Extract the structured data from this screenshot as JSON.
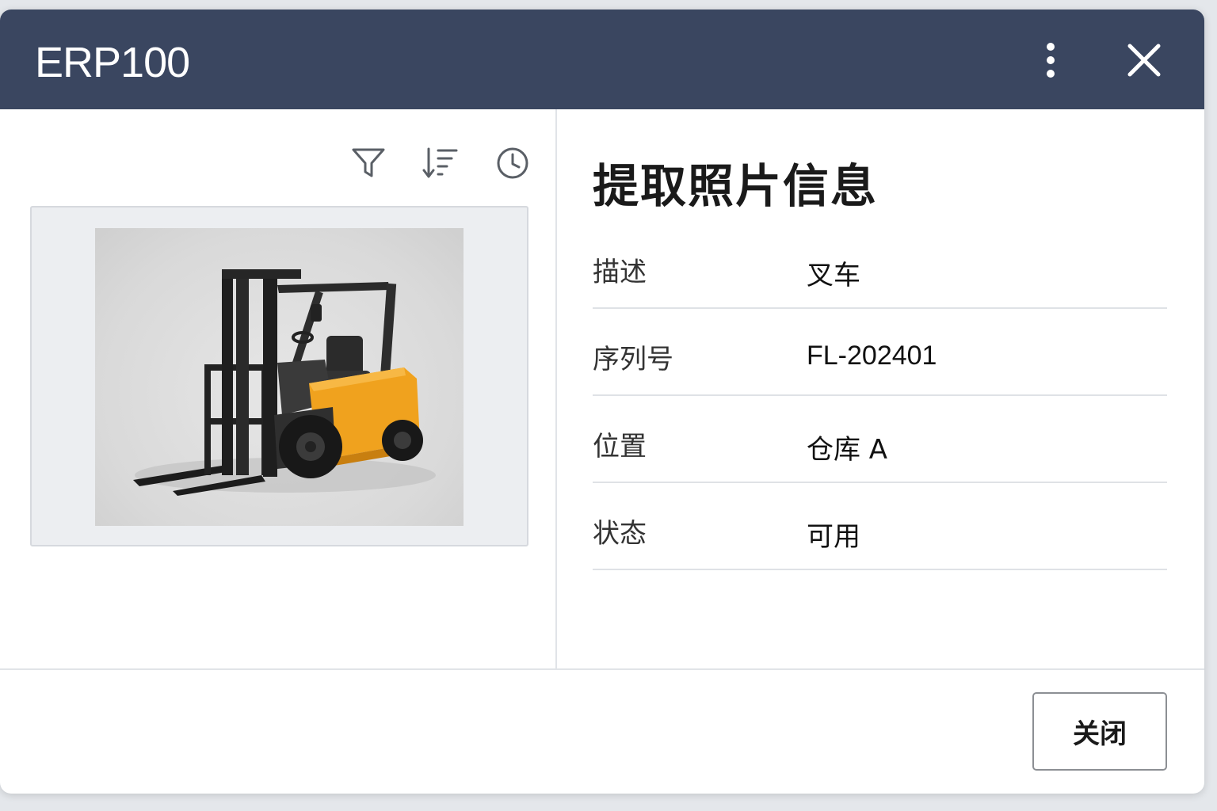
{
  "app": {
    "title": "ERP100",
    "titlebar_color": "#3a4660",
    "icons": [
      "more-vertical-icon",
      "close-icon"
    ]
  },
  "toolbar": {
    "icons": [
      "filter-icon",
      "sort-icon",
      "history-icon"
    ]
  },
  "photo": {
    "subject": "forklift",
    "accent_color": "#f0a21e"
  },
  "info": {
    "title": "提取照片信息",
    "rows": [
      {
        "label": "描述",
        "value": "叉车"
      },
      {
        "label": "序列号",
        "value": "FL-202401"
      },
      {
        "label": "位置",
        "value": "仓库 A"
      },
      {
        "label": "状态",
        "value": "可用"
      }
    ]
  },
  "footer": {
    "close_label": "关闭"
  }
}
